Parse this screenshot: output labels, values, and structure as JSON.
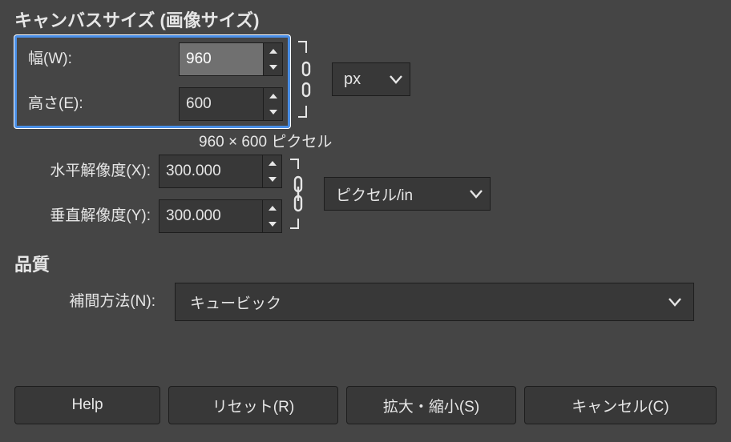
{
  "canvas": {
    "title": "キャンバスサイズ (画像サイズ)",
    "width_label": "幅(W):",
    "height_label": "高さ(E):",
    "width_value": "960",
    "height_value": "600",
    "unit_selected": "px",
    "caption": "960 × 600 ピクセル"
  },
  "resolution": {
    "x_label": "水平解像度(X):",
    "y_label": "垂直解像度(Y):",
    "x_value": "300.000",
    "y_value": "300.000",
    "unit_selected": "ピクセル/in"
  },
  "quality": {
    "title": "品質",
    "interp_label": "補間方法(N):",
    "interp_selected": "キュービック"
  },
  "buttons": {
    "help": "Help",
    "reset": "リセット(R)",
    "scale": "拡大・縮小(S)",
    "cancel": "キャンセル(C)"
  }
}
